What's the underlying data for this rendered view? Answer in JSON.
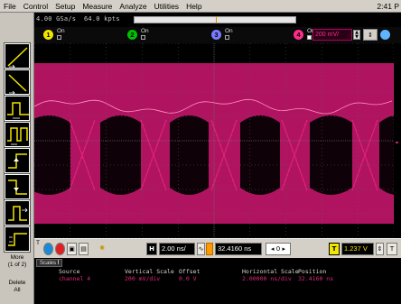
{
  "menu": {
    "items": [
      "File",
      "Control",
      "Setup",
      "Measure",
      "Analyze",
      "Utilities",
      "Help"
    ],
    "clock": "2:41 P"
  },
  "status": {
    "sample_rate": "4.00 GSa/s",
    "memory_depth": "64.0 kpts"
  },
  "channels": [
    {
      "number": "1",
      "state": "On",
      "color": "#f2e600"
    },
    {
      "number": "2",
      "state": "On",
      "color": "#00c000"
    },
    {
      "number": "3",
      "state": "On",
      "color": "#7a7aff"
    },
    {
      "number": "4",
      "state": "On",
      "color": "#ff2d8a",
      "scale": "200 mV/"
    }
  ],
  "side_buttons": {
    "more": "More",
    "more_page": "(1 of 2)",
    "delete": "Delete",
    "delete_all": "All"
  },
  "timebase": {
    "horizontal_scale": "2.00 ns/",
    "position": "32.4160 ns",
    "trigger_level": "1.237 V",
    "nav_value": "0"
  },
  "scales_panel": {
    "tab": "Scales",
    "headers": {
      "source": "Source",
      "vertical_scale": "Vertical Scale",
      "offset": "Offset",
      "horizontal_scale": "Horizontal Scale",
      "position": "Position"
    },
    "row": {
      "source": "channel 4",
      "vertical_scale": "200 mV/div",
      "offset": "0.0 V",
      "horizontal_scale": "2.00000 ns/div",
      "position": "32.4160 ns"
    }
  },
  "icons": {
    "trigger": "trigger-icon",
    "run": "run-button",
    "horizontal": "horizontal-icon",
    "tools": [
      "line-measure-icon",
      "slope-tool-icon",
      "pulse-width-icon",
      "pulse-icon",
      "edge-rise-icon",
      "edge-fall-icon",
      "timeout-icon",
      "window-icon"
    ]
  },
  "colors": {
    "waveform": "#c0176a",
    "ch4": "#ff2d8a",
    "grid": "#5a5a5a"
  }
}
